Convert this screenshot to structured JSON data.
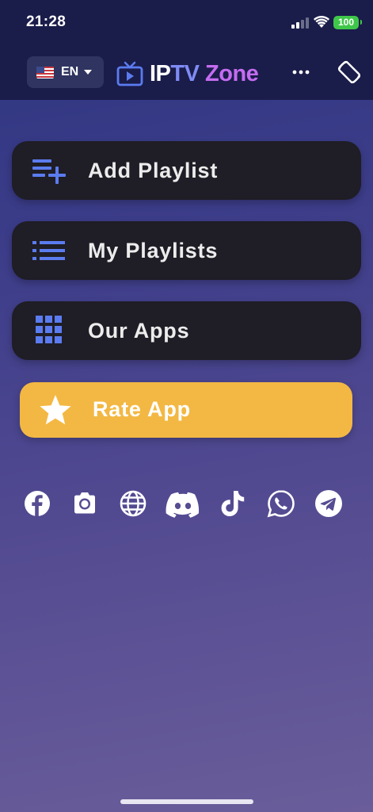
{
  "status_bar": {
    "time": "21:28",
    "battery": "100",
    "battery_color": "#3fc74a"
  },
  "header": {
    "language": {
      "flag": "us-flag-icon",
      "label": "EN"
    },
    "logo": {
      "part1": "IP",
      "part2": "TV",
      "part3": " Zone",
      "icon": "tv-icon"
    },
    "more_icon": "more-dots-icon",
    "rotate_icon": "screen-rotation-icon",
    "background": "#1a1c4a"
  },
  "menu": [
    {
      "label": "Add Playlist",
      "icon": "playlist-add-icon"
    },
    {
      "label": "My Playlists",
      "icon": "list-icon"
    },
    {
      "label": "Our Apps",
      "icon": "grid-icon"
    }
  ],
  "rate": {
    "label": "Rate App",
    "icon": "star-icon",
    "color": "#f3b843"
  },
  "social": [
    "facebook-icon",
    "camera-icon",
    "globe-icon",
    "discord-icon",
    "tiktok-icon",
    "whatsapp-icon",
    "telegram-icon"
  ],
  "colors": {
    "accent": "#5b7cf0",
    "button_bg": "#1f1d25"
  }
}
